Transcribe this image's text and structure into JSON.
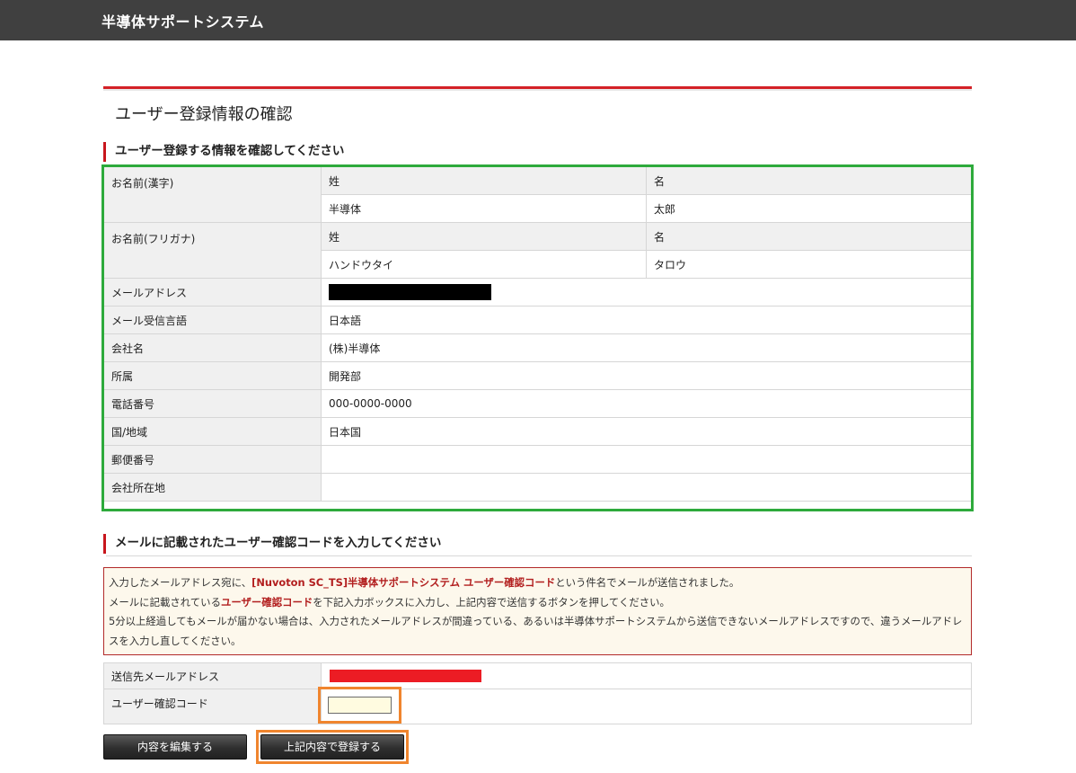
{
  "header": {
    "app_title": "半導体サポートシステム"
  },
  "page": {
    "title": "ユーザー登録情報の確認"
  },
  "section1": {
    "heading": "ユーザー登録する情報を確認してください"
  },
  "info": {
    "name_kanji_label": "お名前(漢字)",
    "name_kana_label": "お名前(フリガナ)",
    "last_name_label": "姓",
    "first_name_label": "名",
    "last_name_kanji": "半導体",
    "first_name_kanji": "太郎",
    "last_name_kana": "ハンドウタイ",
    "first_name_kana": "タロウ",
    "email_label": "メールアドレス",
    "mail_lang_label": "メール受信言語",
    "mail_lang": "日本語",
    "company_label": "会社名",
    "company": "(株)半導体",
    "dept_label": "所属",
    "dept": "開発部",
    "phone_label": "電話番号",
    "phone": "000-0000-0000",
    "country_label": "国/地域",
    "country": "日本国",
    "zip_label": "郵便番号",
    "zip": "",
    "address_label": "会社所在地",
    "address": ""
  },
  "section2": {
    "heading": "メールに記載されたユーザー確認コードを入力してください"
  },
  "notice": {
    "l1_pre": "入力したメールアドレス宛に、",
    "l1_hl": "[Nuvoton SC_TS]半導体サポートシステム ユーザー確認コード",
    "l1_post": "という件名でメールが送信されました。",
    "l2_pre": "メールに記載されている",
    "l2_hl": "ユーザー確認コード",
    "l2_post": "を下記入力ボックスに入力し、上記内容で送信するボタンを押してください。",
    "l3": "5分以上経過してもメールが届かない場合は、入力されたメールアドレスが間違っている、あるいは半導体サポートシステムから送信できないメールアドレスですので、違うメールアドレスを入力し直してください。"
  },
  "confirm": {
    "send_email_label": "送信先メールアドレス",
    "code_label": "ユーザー確認コード",
    "code_value": ""
  },
  "buttons": {
    "edit": "内容を編集する",
    "submit": "上記内容で登録する"
  },
  "colors": {
    "header_bg": "#404040",
    "accent_red": "#d42127",
    "highlight_green": "#2eaa3c",
    "highlight_orange": "#f0852e"
  }
}
